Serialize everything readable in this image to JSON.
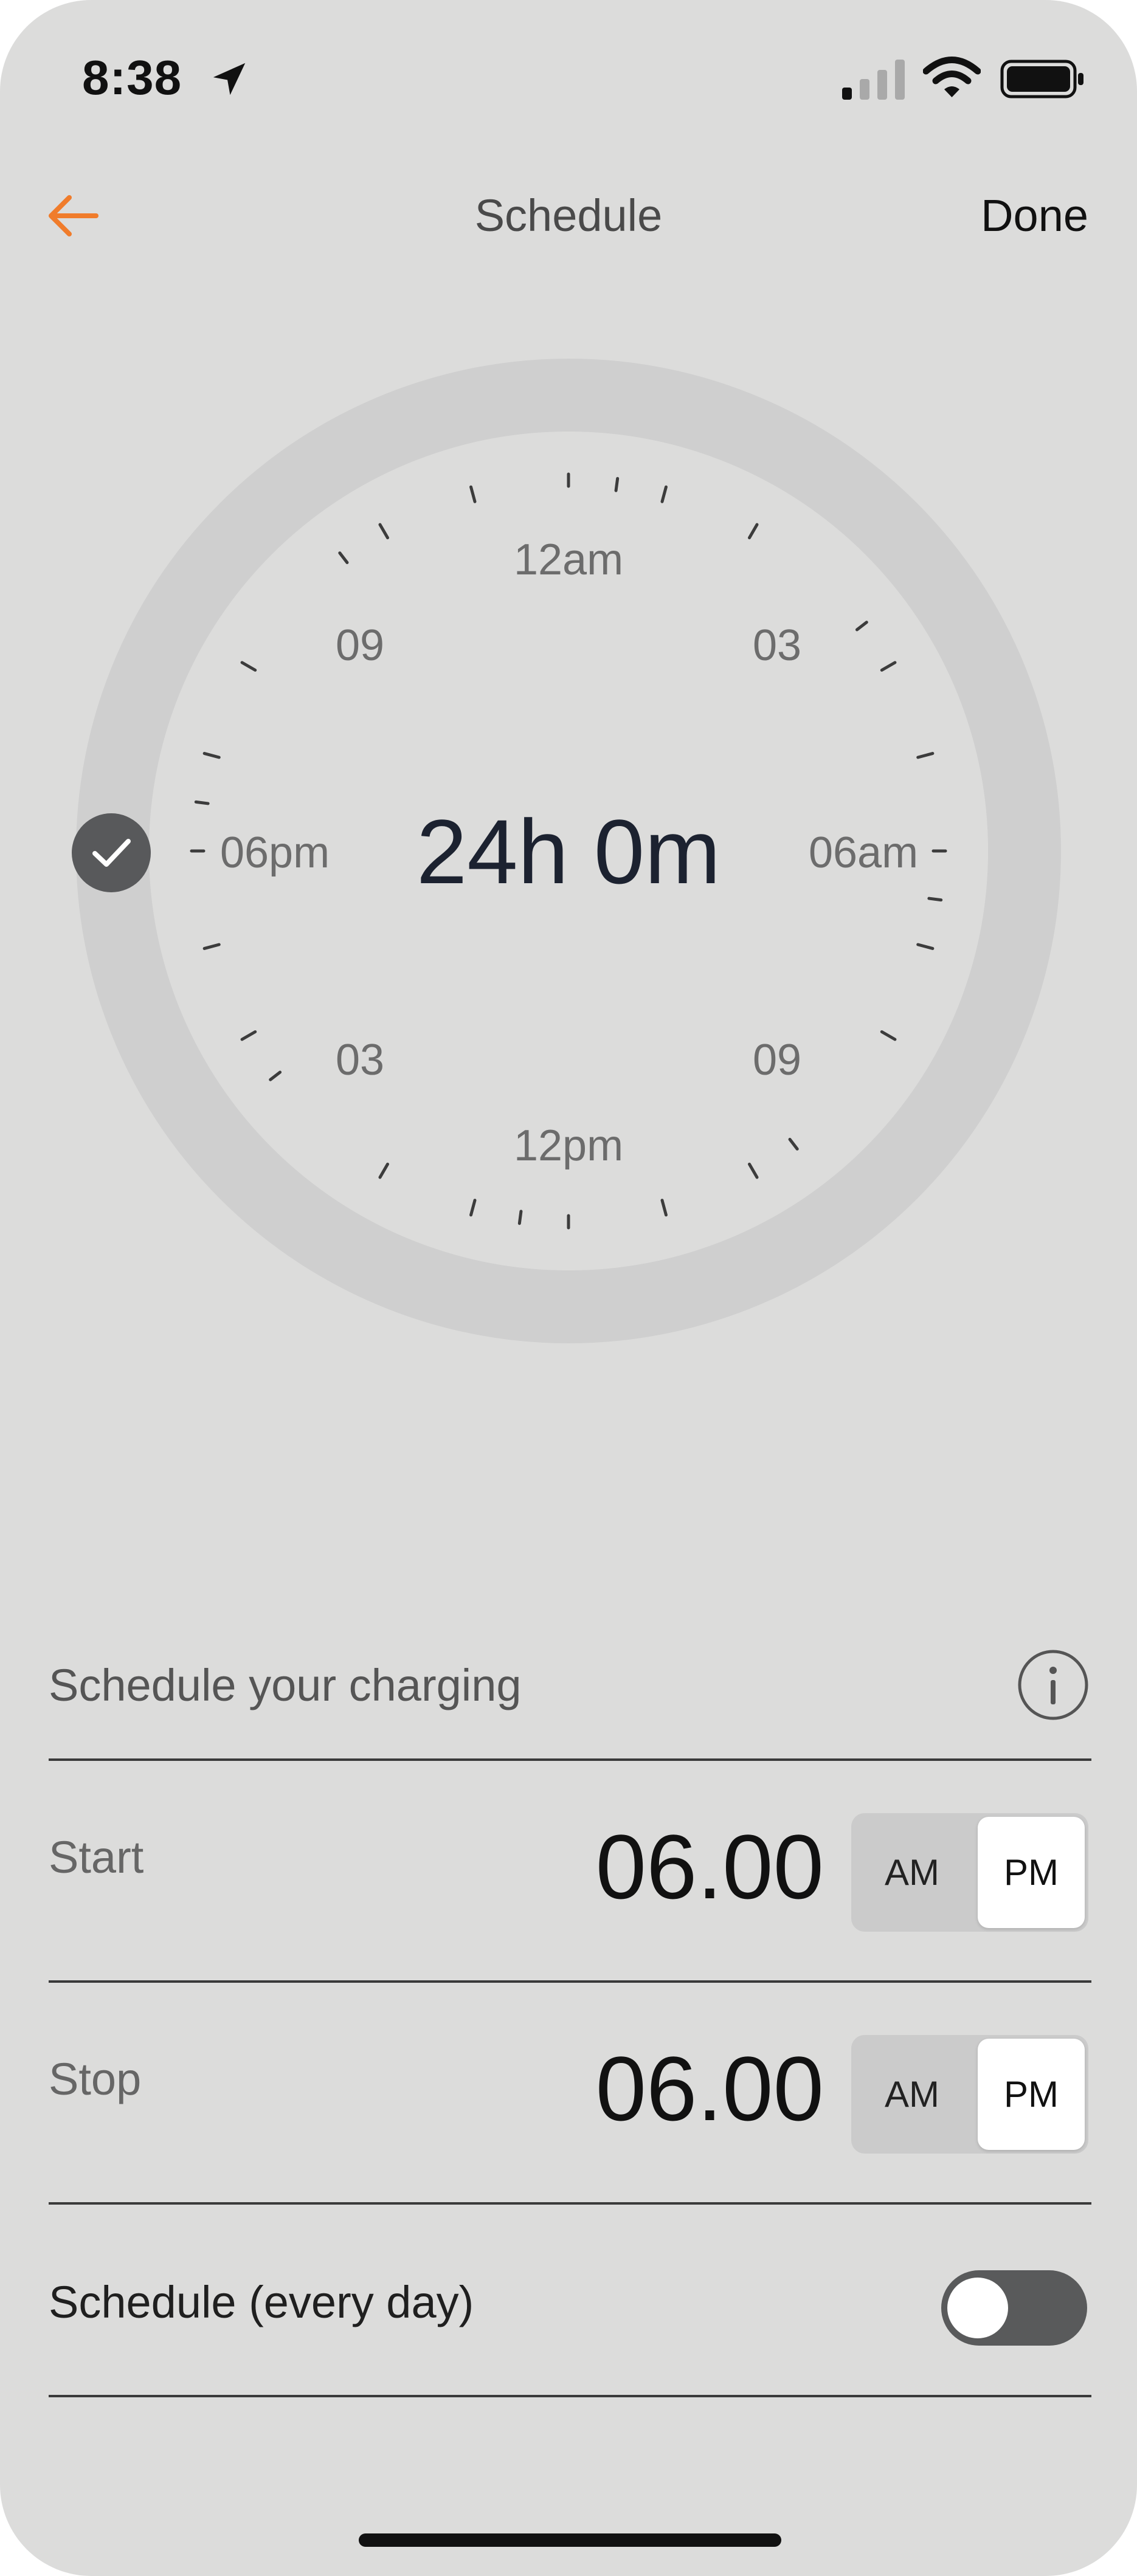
{
  "status_bar": {
    "time": "8:38",
    "icons": [
      "location-arrow-icon",
      "cellular-signal-icon",
      "wifi-icon",
      "battery-icon"
    ]
  },
  "nav": {
    "back_icon": "arrow-left-icon",
    "title": "Schedule",
    "done_label": "Done",
    "accent_color": "#f07c2b"
  },
  "dial": {
    "labels": {
      "top": "12am",
      "top_right": "03",
      "right": "06am",
      "bottom_right": "09",
      "bottom": "12pm",
      "bottom_left": "03",
      "left": "06pm",
      "top_left": "09"
    },
    "duration": "24h 0m",
    "handle_icon": "checkmark-icon"
  },
  "schedule": {
    "title": "Schedule your charging",
    "info_icon": "info-icon",
    "start": {
      "label": "Start",
      "value": "06.00",
      "am_label": "AM",
      "pm_label": "PM",
      "selected": "PM"
    },
    "stop": {
      "label": "Stop",
      "value": "06.00",
      "am_label": "AM",
      "pm_label": "PM",
      "selected": "PM"
    },
    "repeat": {
      "label": "Schedule (every day)",
      "enabled": false
    }
  }
}
